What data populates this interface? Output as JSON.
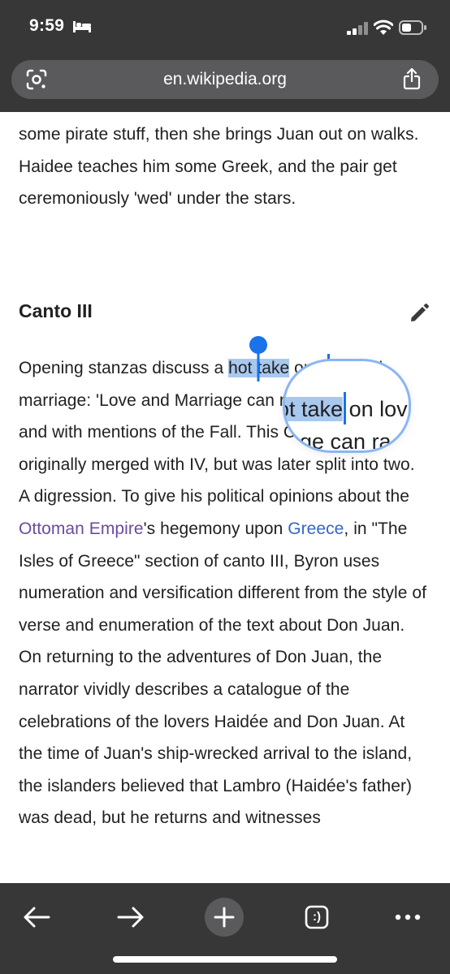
{
  "status_bar": {
    "time": "9:59",
    "icons": [
      "bed-icon",
      "signal-icon",
      "wifi-icon",
      "battery-icon"
    ],
    "battery_level": 0.5
  },
  "url_bar": {
    "url": "en.wikipedia.org",
    "left_icon": "lens-icon",
    "right_icon": "share-icon"
  },
  "article": {
    "intro_text": "some pirate stuff, then she brings Juan out on walks. Haidee teaches him some Greek, and the pair get ceremoniously 'wed' under the stars.",
    "section_heading": "Canto III",
    "edit_icon": "pencil-icon",
    "canto_before_selection": "Opening stanzas discuss a ",
    "selected_text": "hot take",
    "canto_after_selection": " on love and marriage: 'Love and Marriage can rarely combine', and with mentions of the Fall. This Canto was originally merged with IV, but was later split into two. A digression. To give his political opinions about the ",
    "link_ottoman": "Ottoman Empire",
    "canto_mid_1": "'s hegemony upon ",
    "link_greece": "Greece",
    "canto_mid_2": ", in \"The Isles of Greece\" section of canto III, Byron uses numeration and versification different from the style of verse and enumeration of the text about Don Juan. On returning to the adventures of Don Juan, the narrator vividly describes a catalogue of the celebrations of the lovers Haidée and Don Juan. At the time of Juan's ship-wrecked arrival to the island, the islanders believed that Lambro (Haidée's father) was dead, but he returns and witnesses"
  },
  "magnifier": {
    "line1_before": "ot ",
    "line1_selected": "take",
    "line1_after": " on lov",
    "line2": "ge can ra"
  },
  "toolbar": {
    "back": "back-arrow-icon",
    "forward": "forward-arrow-icon",
    "new_tab": "plus-icon",
    "tabs_label": ":)",
    "more": "more-dots-icon"
  },
  "colors": {
    "chrome": "#373738",
    "url_bar": "#5a5a5c",
    "selection": "#a9c8ee",
    "handle": "#1a73e8",
    "link": "#3366cc",
    "visited_link": "#6b4ba1"
  }
}
